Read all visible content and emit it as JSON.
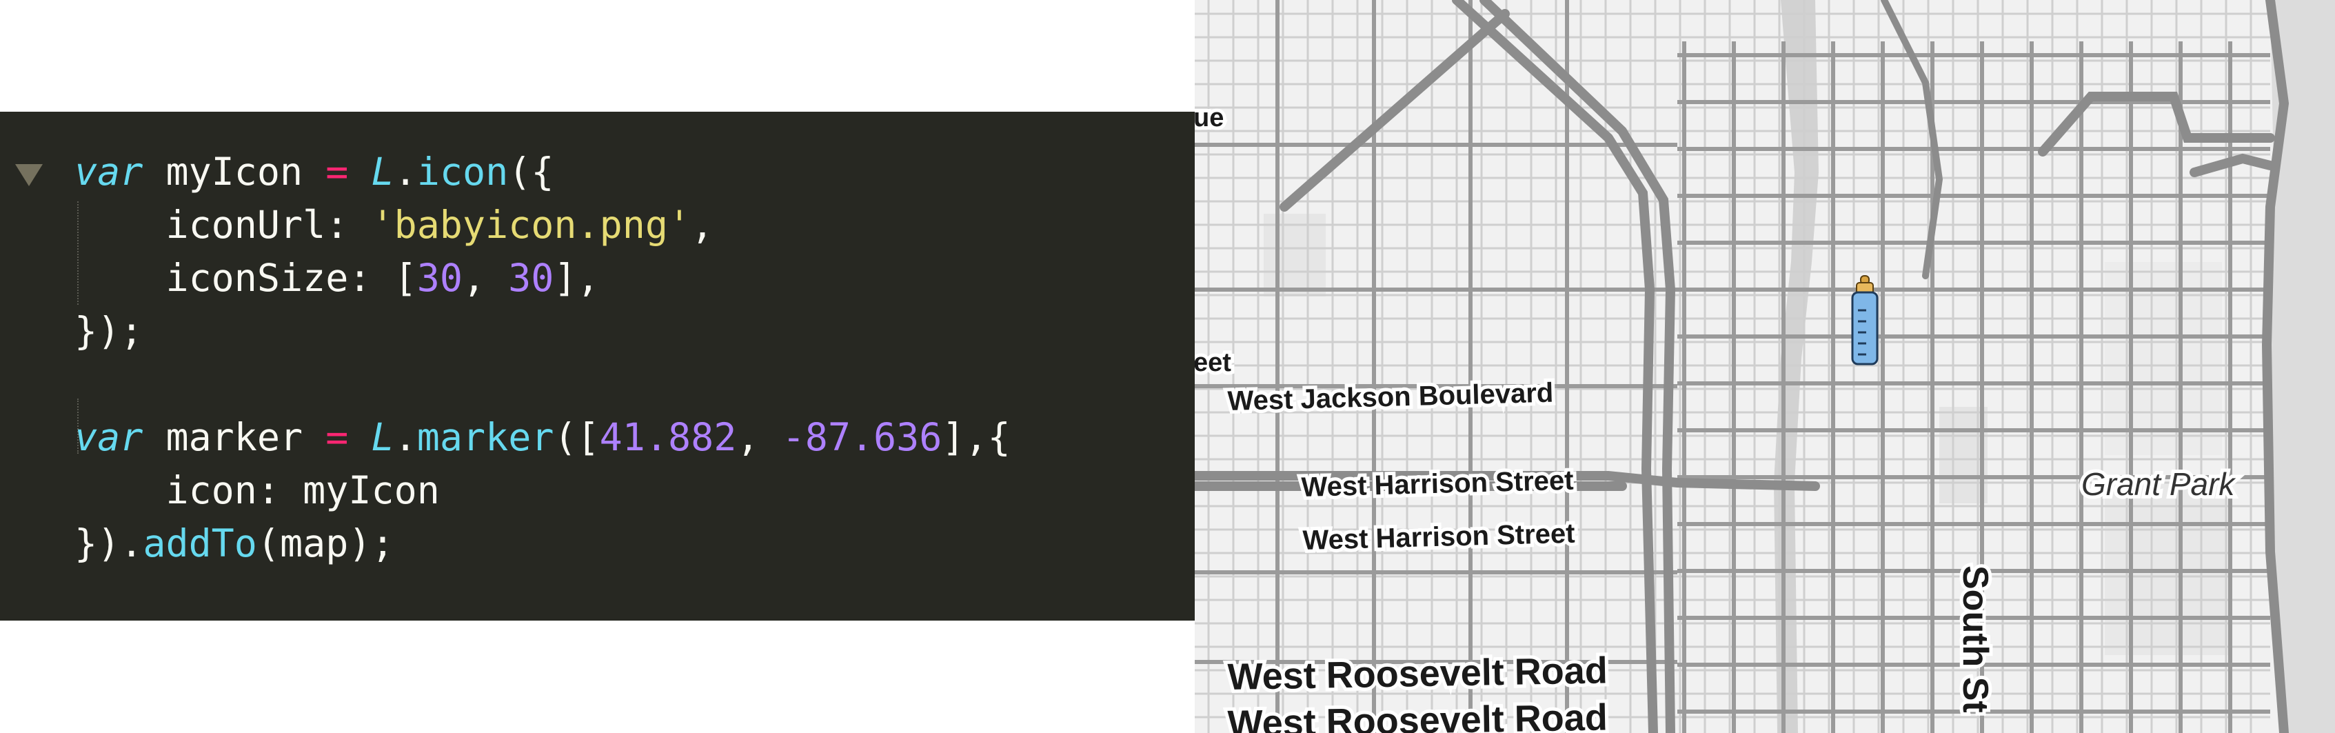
{
  "code": {
    "lines": [
      [
        {
          "t": "var",
          "c": "kw"
        },
        {
          "t": " myIcon ",
          "c": "tx"
        },
        {
          "t": "=",
          "c": "op"
        },
        {
          "t": " ",
          "c": "tx"
        },
        {
          "t": "L",
          "c": "kw"
        },
        {
          "t": ".",
          "c": "tx"
        },
        {
          "t": "icon",
          "c": "fn"
        },
        {
          "t": "({",
          "c": "tx"
        }
      ],
      [
        {
          "t": "    iconUrl: ",
          "c": "tx"
        },
        {
          "t": "'babyicon.png'",
          "c": "str"
        },
        {
          "t": ",",
          "c": "tx"
        }
      ],
      [
        {
          "t": "    iconSize: [",
          "c": "tx"
        },
        {
          "t": "30",
          "c": "num"
        },
        {
          "t": ", ",
          "c": "tx"
        },
        {
          "t": "30",
          "c": "num"
        },
        {
          "t": "],",
          "c": "tx"
        }
      ],
      [
        {
          "t": "});",
          "c": "tx"
        }
      ],
      [],
      [
        {
          "t": "var",
          "c": "kw"
        },
        {
          "t": " marker ",
          "c": "tx"
        },
        {
          "t": "=",
          "c": "op"
        },
        {
          "t": " ",
          "c": "tx"
        },
        {
          "t": "L",
          "c": "kw"
        },
        {
          "t": ".",
          "c": "tx"
        },
        {
          "t": "marker",
          "c": "fn"
        },
        {
          "t": "([",
          "c": "tx"
        },
        {
          "t": "41.882",
          "c": "num"
        },
        {
          "t": ", ",
          "c": "tx"
        },
        {
          "t": "-87.636",
          "c": "num"
        },
        {
          "t": "],{",
          "c": "tx"
        }
      ],
      [
        {
          "t": "    icon: myIcon",
          "c": "tx"
        }
      ],
      [
        {
          "t": "}).",
          "c": "tx"
        },
        {
          "t": "addTo",
          "c": "fn"
        },
        {
          "t": "(map);",
          "c": "tx"
        }
      ]
    ]
  },
  "colors": {
    "editor_background": "#272822",
    "keyword": "#66d9ef",
    "operator": "#f92672",
    "string": "#e6db74",
    "number": "#ae81ff",
    "text": "#f8f8f2",
    "map_background": "#f1f1f1",
    "map_road": "#8c8c8c",
    "map_water": "#d2d2d2",
    "marker_bottle": "#7fb7e8"
  },
  "map": {
    "labels": {
      "avenue_partial": "ue",
      "street_partial": "eet",
      "jackson": "West Jackson Boulevard",
      "harrison_1": "West Harrison Street",
      "harrison_2": "West Harrison Street",
      "grant_park": "Grant Park",
      "south_st": "South St",
      "roosevelt_1": "West Roosevelt Road",
      "roosevelt_2": "West Roosevelt Road"
    },
    "marker": {
      "icon": "baby-bottle-icon"
    }
  }
}
